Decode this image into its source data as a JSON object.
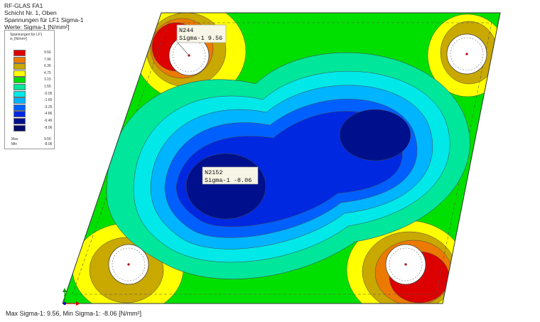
{
  "header": {
    "line1": "RF-GLAS FA1",
    "line2": "Schicht Nr. 1, Oben",
    "line3": "Spannungen für LF1 Sigma-1",
    "line4": "Werte: Sigma-1 [N/mm^2]"
  },
  "legend": {
    "title1": "Spannungen für LF1",
    "title2": "σ₁ [N/mm²]",
    "rows": [
      {
        "color": "#dc0000",
        "value": "9.56"
      },
      {
        "color": "#ec7a00",
        "value": "7.96"
      },
      {
        "color": "#c9a800",
        "value": "6.36"
      },
      {
        "color": "#ffff00",
        "value": "4.75"
      },
      {
        "color": "#00e000",
        "value": "3.15"
      },
      {
        "color": "#00e69a",
        "value": "1.55"
      },
      {
        "color": "#00e8e8",
        "value": "-0.05"
      },
      {
        "color": "#00b4ff",
        "value": "-1.65"
      },
      {
        "color": "#0060ff",
        "value": "-3.25"
      },
      {
        "color": "#0028e0",
        "value": "-4.86"
      },
      {
        "color": "#00108c",
        "value": "-6.46"
      },
      {
        "color": "#000c6a",
        "value": "-8.06"
      }
    ],
    "max_label": "Max",
    "max_value": "9.56",
    "min_label": "Min",
    "min_value": "-8.06"
  },
  "labels": {
    "max_node": "N244",
    "max_text": "Sigma-1  9.56",
    "min_node": "N2152",
    "min_text": "Sigma-1  -8.06"
  },
  "footer": "Max Sigma-1: 9.56, Min Sigma-1: -8.06 [N/mm²]",
  "colors": {
    "green": "#00e000",
    "teal": "#00e69a",
    "cyan": "#00e8e8",
    "blue1": "#00b4ff",
    "blue2": "#0060ff",
    "blue3": "#0028e0",
    "blue4": "#00108c",
    "yellow": "#ffff00",
    "olive": "#c9a800",
    "orange": "#ec7a00",
    "red": "#dc0000"
  }
}
